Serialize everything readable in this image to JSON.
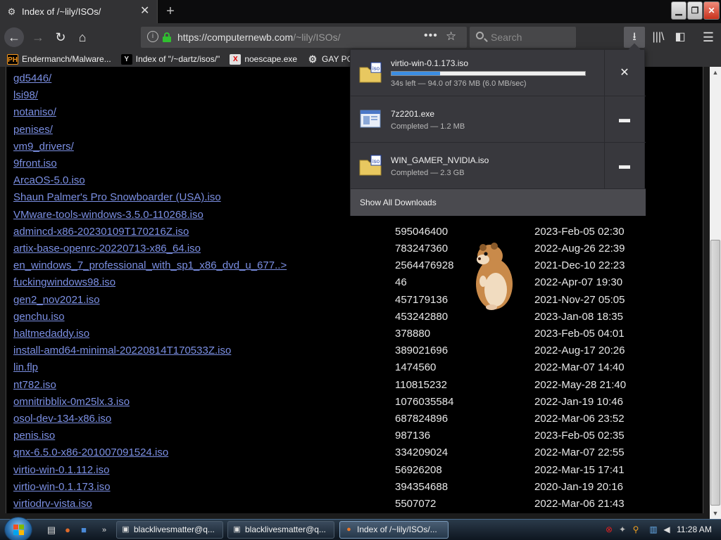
{
  "browser": {
    "tab_title": "Index of /~lily/ISOs/",
    "url_host": "https://computernewb.com",
    "url_path": "/~lily/ISOs/",
    "search_placeholder": "Search",
    "bookmarks": [
      {
        "label": "Endermanch/Malware...",
        "icon": "pornhub-icon",
        "badge": "PH"
      },
      {
        "label": "Index of \"/~dartz/isos/\"",
        "icon": "ycombinator-icon",
        "badge": "Y"
      },
      {
        "label": "noescape.exe",
        "icon": "x-icon",
        "badge": "X"
      },
      {
        "label": "GAY POR",
        "icon": "gear-icon",
        "badge": "⚙"
      }
    ]
  },
  "downloads": {
    "items": [
      {
        "name": "virtio-win-0.1.173.iso",
        "status": "34s left — 94.0 of 376 MB (6.0 MB/sec)",
        "icon": "iso-file-icon",
        "progress": 0.25,
        "action": "cancel"
      },
      {
        "name": "7z2201.exe",
        "status": "Completed — 1.2 MB",
        "icon": "exe-file-icon",
        "action": "open-folder"
      },
      {
        "name": "WIN_GAMER_NVIDIA.iso",
        "status": "Completed — 2.3 GB",
        "icon": "iso-file-icon",
        "action": "open-folder"
      }
    ],
    "show_all_label": "Show All Downloads"
  },
  "listing": {
    "rows": [
      {
        "name": "gd5446/",
        "size": "",
        "date": ""
      },
      {
        "name": "lsi98/",
        "size": "",
        "date": ""
      },
      {
        "name": "notaniso/",
        "size": "",
        "date": ""
      },
      {
        "name": "penises/",
        "size": "",
        "date": ""
      },
      {
        "name": "vm9_drivers/",
        "size": "",
        "date": ""
      },
      {
        "name": "9front.iso",
        "size": "",
        "date": ""
      },
      {
        "name": "ArcaOS-5.0.iso",
        "size": "",
        "date": ""
      },
      {
        "name": "Shaun Palmer's Pro Snowboarder (USA).iso",
        "size": "",
        "date": ""
      },
      {
        "name": "VMware-tools-windows-3.5.0-110268.iso",
        "size": "",
        "date": ""
      },
      {
        "name": "admincd-x86-20230109T170216Z.iso",
        "size": "595046400",
        "date": "2023-Feb-05 02:30"
      },
      {
        "name": "artix-base-openrc-20220713-x86_64.iso",
        "size": "783247360",
        "date": "2022-Aug-26 22:39"
      },
      {
        "name": "en_windows_7_professional_with_sp1_x86_dvd_u_677..>",
        "size": "2564476928",
        "date": "2021-Dec-10 22:23"
      },
      {
        "name": "fuckingwindows98.iso",
        "size": "46",
        "date": "2022-Apr-07 19:30"
      },
      {
        "name": "gen2_nov2021.iso",
        "size": "457179136",
        "date": "2021-Nov-27 05:05"
      },
      {
        "name": "genchu.iso",
        "size": "453242880",
        "date": "2023-Jan-08 18:35"
      },
      {
        "name": "haltmedaddy.iso",
        "size": "378880",
        "date": "2023-Feb-05 04:01"
      },
      {
        "name": "install-amd64-minimal-20220814T170533Z.iso",
        "size": "389021696",
        "date": "2022-Aug-17 20:26"
      },
      {
        "name": "lin.flp",
        "size": "1474560",
        "date": "2022-Mar-07 14:40"
      },
      {
        "name": "nt782.iso",
        "size": "110815232",
        "date": "2022-May-28 21:40"
      },
      {
        "name": "omnitribblix-0m25lx.3.iso",
        "size": "1076035584",
        "date": "2022-Jan-19 10:46"
      },
      {
        "name": "osol-dev-134-x86.iso",
        "size": "687824896",
        "date": "2022-Mar-06 23:52"
      },
      {
        "name": "penis.iso",
        "size": "987136",
        "date": "2023-Feb-05 02:35"
      },
      {
        "name": "qnx-6.5.0-x86-201007091524.iso",
        "size": "334209024",
        "date": "2022-Mar-07 22:55"
      },
      {
        "name": "virtio-win-0.1.112.iso",
        "size": "56926208",
        "date": "2022-Mar-15 17:41"
      },
      {
        "name": "virtio-win-0.1.173.iso",
        "size": "394354688",
        "date": "2020-Jan-19 20:16"
      },
      {
        "name": "virtiodrv-vista.iso",
        "size": "5507072",
        "date": "2022-Mar-06 21:43"
      }
    ]
  },
  "taskbar": {
    "buttons": [
      {
        "label": "blacklivesmatter@q...",
        "icon": "terminal-icon",
        "active": false
      },
      {
        "label": "blacklivesmatter@q...",
        "icon": "terminal-icon",
        "active": false
      },
      {
        "label": "Index of /~lily/ISOs/...",
        "icon": "firefox-icon",
        "active": true
      }
    ],
    "clock": "11:28 AM"
  }
}
